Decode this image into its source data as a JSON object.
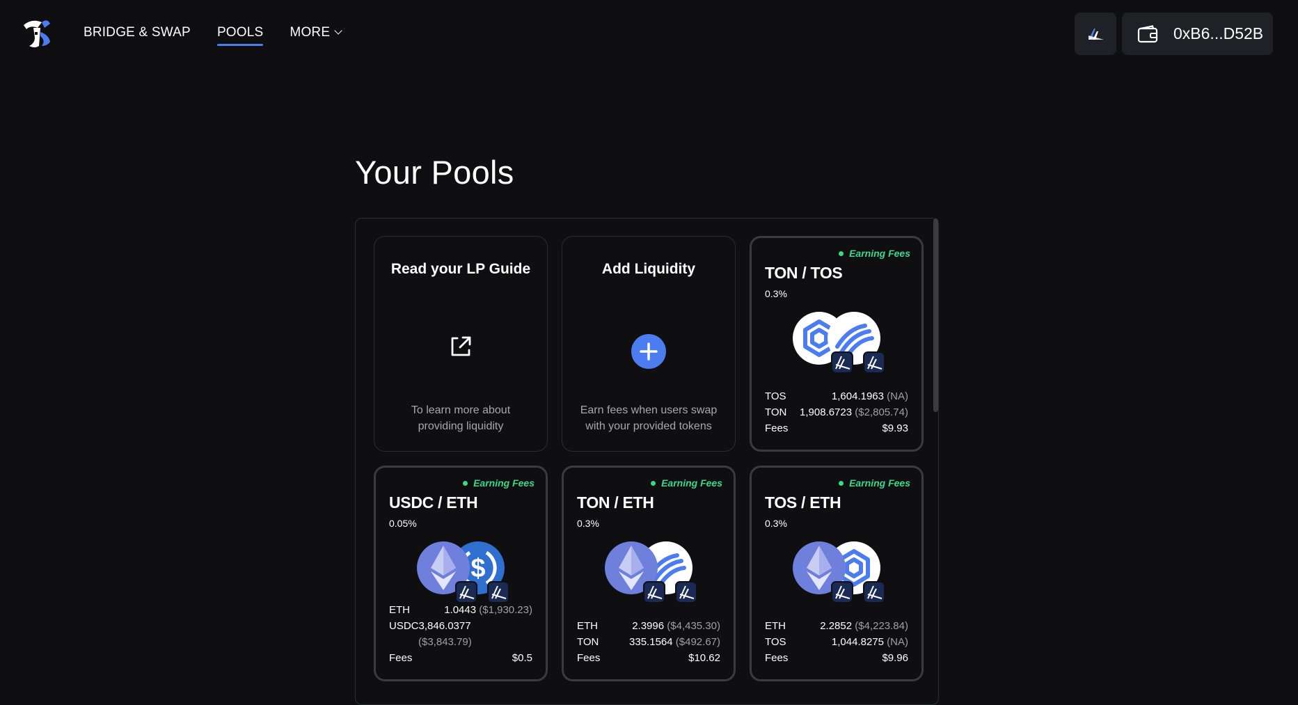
{
  "nav": {
    "items": [
      {
        "label": "BRIDGE & SWAP",
        "active": false
      },
      {
        "label": "POOLS",
        "active": true
      },
      {
        "label": "MORE",
        "active": false,
        "dropdown": true
      }
    ]
  },
  "wallet": {
    "address": "0xB6...D52B",
    "icon": "wallet-icon",
    "network_icon": "network-icon"
  },
  "page": {
    "title": "Your Pools"
  },
  "static_cards": {
    "guide": {
      "title": "Read your LP Guide",
      "desc": "To learn more about providing liquidity",
      "icon": "external-link-icon"
    },
    "add": {
      "title": "Add Liquidity",
      "desc": "Earn fees when users swap with your provided tokens",
      "icon": "plus-icon"
    }
  },
  "pools": [
    {
      "status": "Earning Fees",
      "pair": "TON / TOS",
      "fee_tier": "0.3%",
      "tokens": [
        "ton",
        "tos"
      ],
      "rows": [
        {
          "symbol": "TOS",
          "amount": "1,604.1963",
          "usd": "(NA)"
        },
        {
          "symbol": "TON",
          "amount": "1,908.6723",
          "usd": "($2,805.74)"
        }
      ],
      "fees_label": "Fees",
      "fees": "$9.93"
    },
    {
      "status": "Earning Fees",
      "pair": "USDC / ETH",
      "fee_tier": "0.05%",
      "tokens": [
        "eth",
        "usdc"
      ],
      "rows": [
        {
          "symbol": "ETH",
          "amount": "1.0443",
          "usd": "($1,930.23)"
        },
        {
          "symbol": "USDC",
          "amount": "3,846.0377",
          "usd": "($3,843.79)"
        }
      ],
      "fees_label": "Fees",
      "fees": "$0.5"
    },
    {
      "status": "Earning Fees",
      "pair": "TON / ETH",
      "fee_tier": "0.3%",
      "tokens": [
        "eth",
        "ton"
      ],
      "rows": [
        {
          "symbol": "ETH",
          "amount": "2.3996",
          "usd": "($4,435.30)"
        },
        {
          "symbol": "TON",
          "amount": "335.1564",
          "usd": "($492.67)"
        }
      ],
      "fees_label": "Fees",
      "fees": "$10.62"
    },
    {
      "status": "Earning Fees",
      "pair": "TOS / ETH",
      "fee_tier": "0.3%",
      "tokens": [
        "eth",
        "tos"
      ],
      "rows": [
        {
          "symbol": "ETH",
          "amount": "2.2852",
          "usd": "($4,223.84)"
        },
        {
          "symbol": "TOS",
          "amount": "1,044.8275",
          "usd": "(NA)"
        }
      ],
      "fees_label": "Fees",
      "fees": "$9.96"
    }
  ],
  "colors": {
    "accent": "#4c7df0",
    "earning": "#3ad98a",
    "background": "#0f0f12",
    "eth": "#6f7fdc",
    "usdc": "#2f6fd0"
  }
}
